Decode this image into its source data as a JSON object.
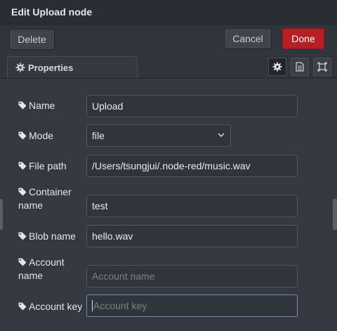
{
  "dialog": {
    "title": "Edit Upload node"
  },
  "toolbar": {
    "delete_label": "Delete",
    "cancel_label": "Cancel",
    "done_label": "Done"
  },
  "tabs": {
    "properties_label": "Properties",
    "icons": [
      "gear-icon",
      "document-icon",
      "frame-icon"
    ]
  },
  "form": {
    "name": {
      "label": "Name",
      "value": "Upload"
    },
    "mode": {
      "label": "Mode",
      "value": "file"
    },
    "file_path": {
      "label": "File path",
      "value": "/Users/tsungjui/.node-red/music.wav"
    },
    "container_name": {
      "label_line1": "Container",
      "label_line2": "name",
      "value": "test"
    },
    "blob_name": {
      "label": "Blob name",
      "value": "hello.wav"
    },
    "account_name": {
      "label_line1": "Account",
      "label_line2": "name",
      "value": "",
      "placeholder": "Account name"
    },
    "account_key": {
      "label": "Account key",
      "value": "",
      "placeholder": "Account key"
    }
  },
  "colors": {
    "done_button": "#b62025",
    "background": "#343841",
    "focus_border": "#6c8fb8"
  }
}
